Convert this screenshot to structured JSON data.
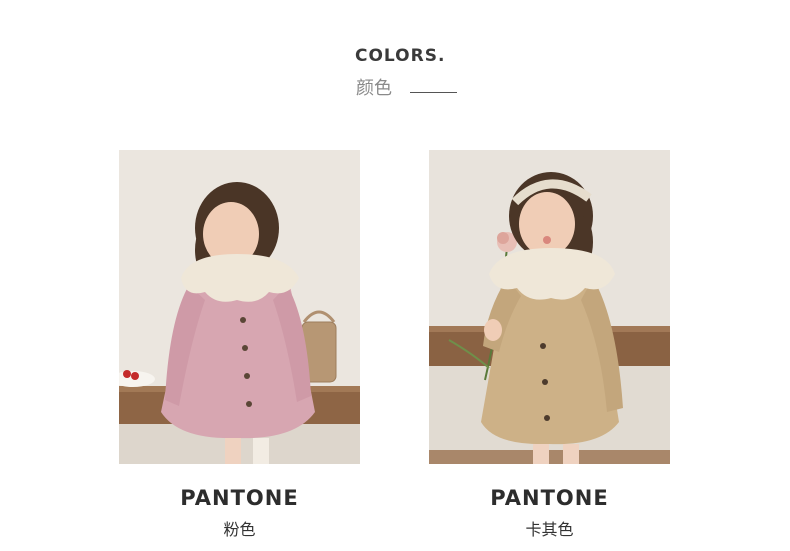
{
  "header": {
    "title": "COLORS.",
    "subtitle": "颜色"
  },
  "swatches": [
    {
      "pantone_label": "PANTONE",
      "color_name": "粉色",
      "coat_color": "#d9a8b3"
    },
    {
      "pantone_label": "PANTONE",
      "color_name": "卡其色",
      "coat_color": "#cdb187"
    }
  ],
  "colors": {
    "wall": "#e9e4dd",
    "bench": "#8d6443"
  }
}
